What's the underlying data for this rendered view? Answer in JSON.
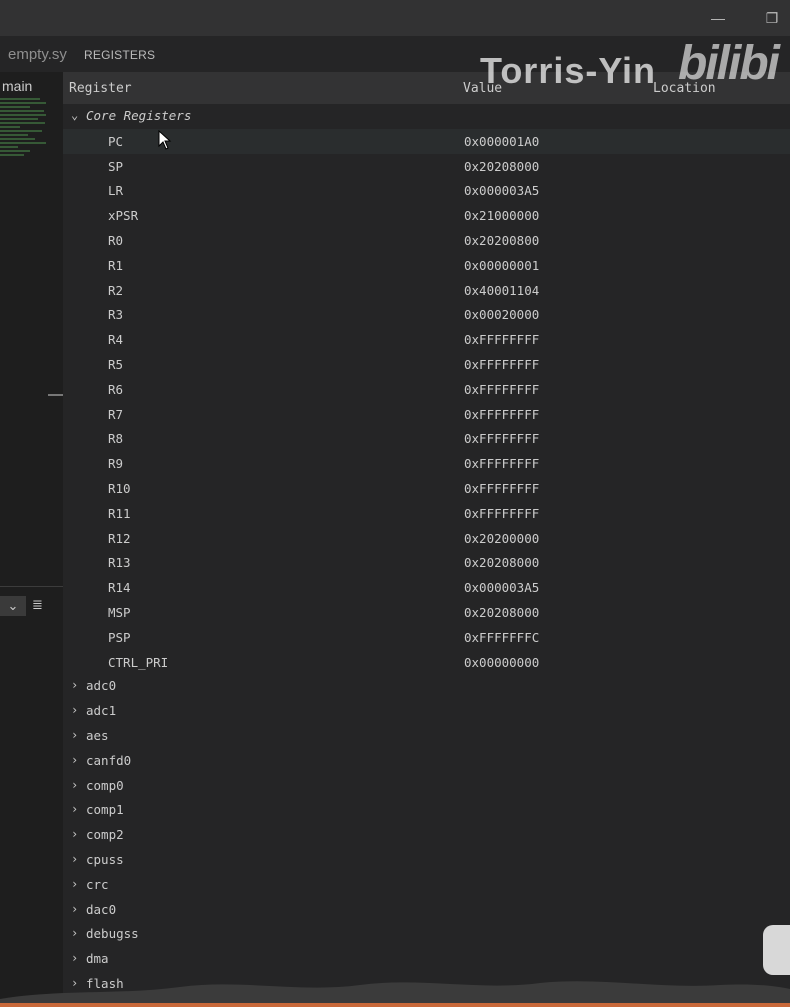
{
  "tabs": {
    "editor_tab": "empty.sy",
    "panel_tab": "REGISTERS"
  },
  "left": {
    "label": "main"
  },
  "columns": {
    "register": "Register",
    "value": "Value",
    "location": "Location"
  },
  "watermark": {
    "text": "Torris-Yin",
    "logo": "bilibi"
  },
  "groups": {
    "core": "Core Registers"
  },
  "registers": [
    {
      "name": "PC",
      "value": "0x000001A0"
    },
    {
      "name": "SP",
      "value": "0x20208000"
    },
    {
      "name": "LR",
      "value": "0x000003A5"
    },
    {
      "name": "xPSR",
      "value": "0x21000000"
    },
    {
      "name": "R0",
      "value": "0x20200800"
    },
    {
      "name": "R1",
      "value": "0x00000001"
    },
    {
      "name": "R2",
      "value": "0x40001104"
    },
    {
      "name": "R3",
      "value": "0x00020000"
    },
    {
      "name": "R4",
      "value": "0xFFFFFFFF"
    },
    {
      "name": "R5",
      "value": "0xFFFFFFFF"
    },
    {
      "name": "R6",
      "value": "0xFFFFFFFF"
    },
    {
      "name": "R7",
      "value": "0xFFFFFFFF"
    },
    {
      "name": "R8",
      "value": "0xFFFFFFFF"
    },
    {
      "name": "R9",
      "value": "0xFFFFFFFF"
    },
    {
      "name": "R10",
      "value": "0xFFFFFFFF"
    },
    {
      "name": "R11",
      "value": "0xFFFFFFFF"
    },
    {
      "name": "R12",
      "value": "0x20200000"
    },
    {
      "name": "R13",
      "value": "0x20208000"
    },
    {
      "name": "R14",
      "value": "0x000003A5"
    },
    {
      "name": "MSP",
      "value": "0x20208000"
    },
    {
      "name": "PSP",
      "value": "0xFFFFFFFC"
    },
    {
      "name": "CTRL_PRI",
      "value": "0x00000000"
    }
  ],
  "peripherals": [
    "adc0",
    "adc1",
    "aes",
    "canfd0",
    "comp0",
    "comp1",
    "comp2",
    "cpuss",
    "crc",
    "dac0",
    "debugss",
    "dma",
    "flash"
  ]
}
